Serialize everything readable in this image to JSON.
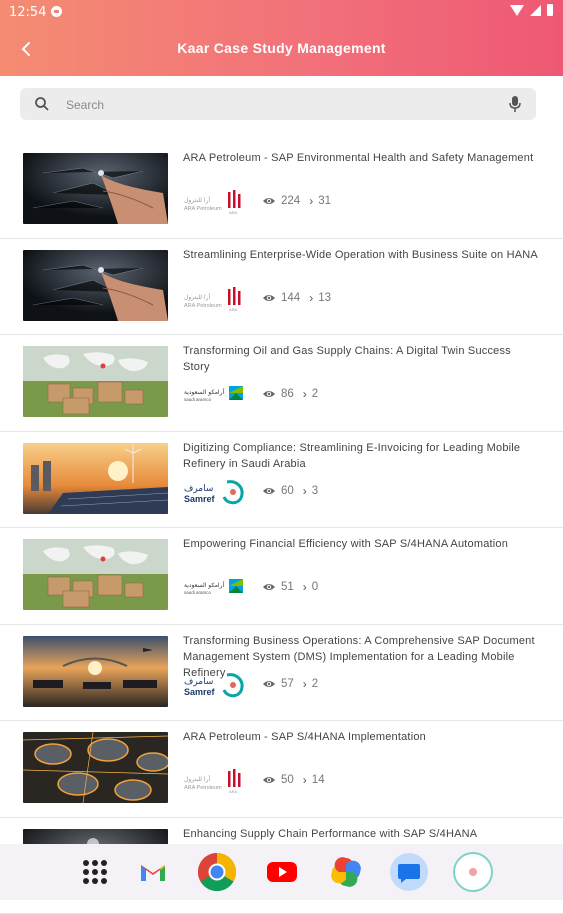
{
  "status": {
    "time": "12:54"
  },
  "header": {
    "title": "Kaar Case Study Management"
  },
  "search": {
    "placeholder": "Search"
  },
  "case_studies": [
    {
      "title": "ARA Petroleum - SAP Environmental Health and Safety Management",
      "company": "ARA Petroleum",
      "views": "224",
      "count": "31",
      "image": "touch-tech"
    },
    {
      "title": "Streamlining Enterprise-Wide Operation with Business Suite on HANA",
      "company": "ARA Petroleum",
      "views": "144",
      "count": "13",
      "image": "touch-tech"
    },
    {
      "title": "Transforming Oil and Gas Supply Chains: A Digital Twin Success Story",
      "company": "Saudi Aramco",
      "views": "86",
      "count": "2",
      "image": "world-map-boxes"
    },
    {
      "title": "Digitizing Compliance: Streamlining E-Invoicing for Leading Mobile Refinery in Saudi Arabia",
      "company": "Samref",
      "views": "60",
      "count": "3",
      "image": "energy-sunset"
    },
    {
      "title": "Empowering Financial Efficiency with SAP S/4HANA Automation",
      "company": "Saudi Aramco",
      "views": "51",
      "count": "0",
      "image": "world-map-boxes"
    },
    {
      "title": "Transforming Business Operations: A Comprehensive SAP Document Management System (DMS) Implementation for a Leading Mobile Refinery",
      "company": "Samref",
      "views": "57",
      "count": "2",
      "image": "logistics-sunset"
    },
    {
      "title": "ARA Petroleum - SAP S/4HANA Implementation",
      "company": "ARA Petroleum",
      "views": "50",
      "count": "14",
      "image": "refinery-tanks"
    },
    {
      "title": "Enhancing Supply Chain Performance with SAP S/4HANA",
      "company": "",
      "views": "",
      "count": "",
      "image": "dark-tech"
    }
  ],
  "dock": [
    "apps-grid-icon",
    "gmail-icon",
    "chrome-icon",
    "youtube-icon",
    "photos-icon",
    "messages-icon",
    "app-icon"
  ],
  "colors": {
    "header_start": "#f48c72",
    "header_end": "#ee5874"
  }
}
